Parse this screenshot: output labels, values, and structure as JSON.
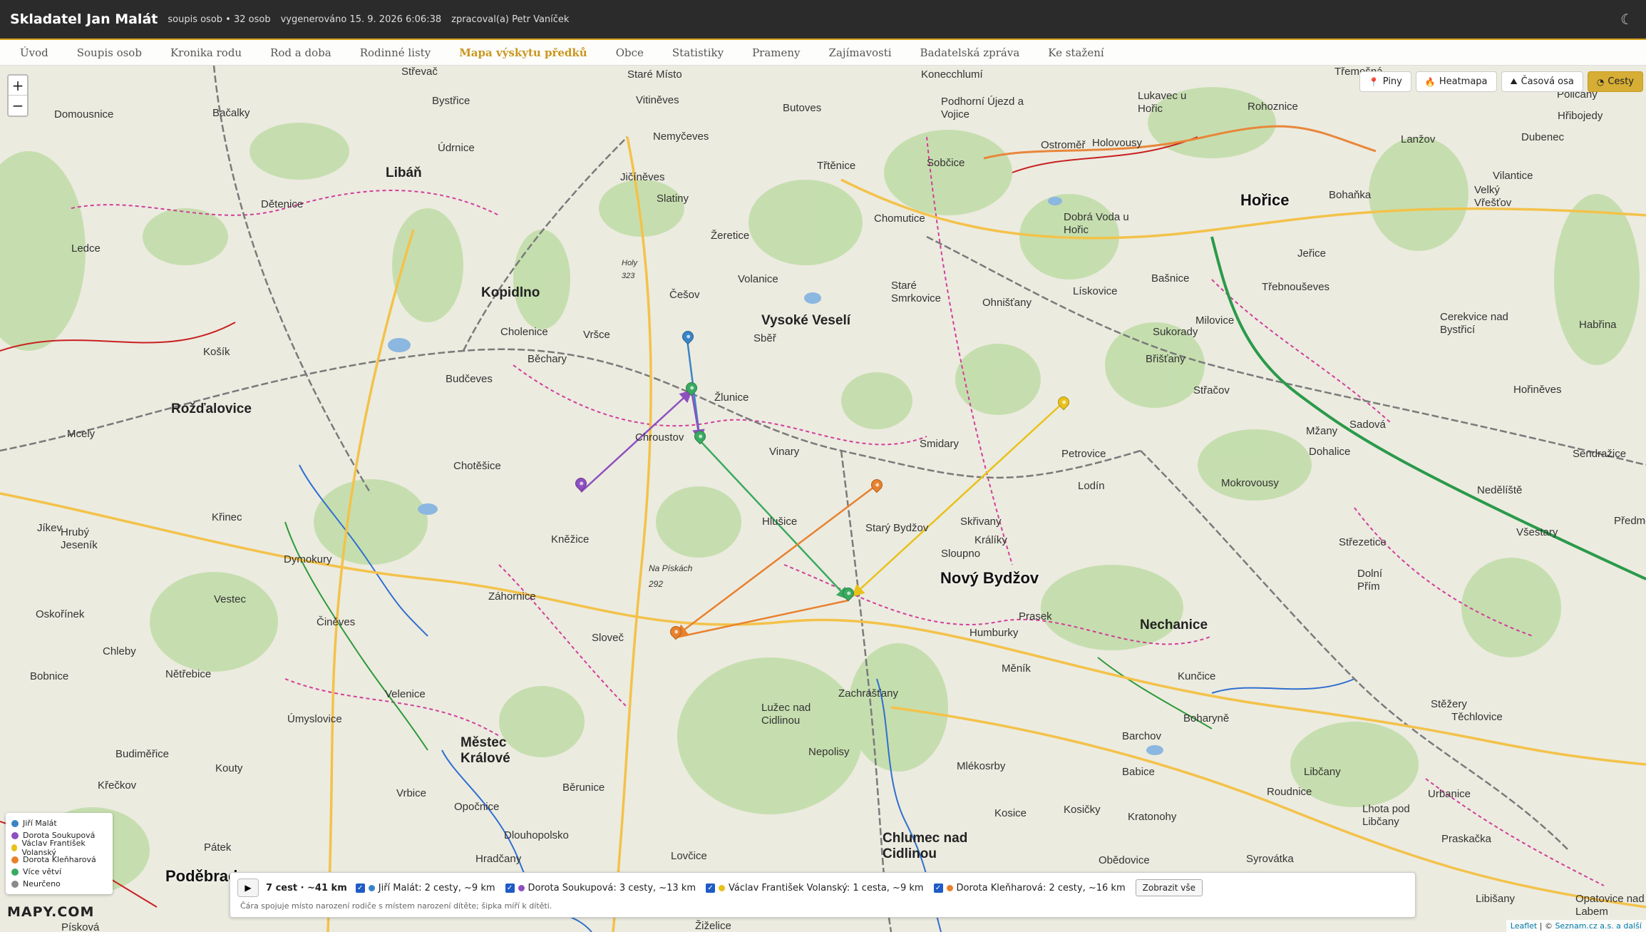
{
  "app": {
    "title": "Skladatel Jan Malát",
    "count": "soupis osob • 32 osob",
    "generated": "vygenerováno 15. 9. 2026 6:06:38",
    "author": "zpracoval(a) Petr Vaníček",
    "theme_icon": "moon-icon"
  },
  "nav": [
    {
      "label": "Úvod"
    },
    {
      "label": "Soupis osob"
    },
    {
      "label": "Kronika rodu"
    },
    {
      "label": "Rod a doba"
    },
    {
      "label": "Rodinné listy"
    },
    {
      "label": "Mapa výskytu předků",
      "active": true
    },
    {
      "label": "Obce"
    },
    {
      "label": "Statistiky"
    },
    {
      "label": "Prameny"
    },
    {
      "label": "Zajímavosti"
    },
    {
      "label": "Badatelská zpráva"
    },
    {
      "label": "Ke stažení"
    }
  ],
  "map": {
    "zoom_in": "+",
    "zoom_out": "−",
    "modes": [
      {
        "label": "Piny",
        "icon": "pin-icon"
      },
      {
        "label": "Heatmapa",
        "icon": "flame-icon"
      },
      {
        "label": "Časová osa",
        "icon": "mountain-icon"
      },
      {
        "label": "Cesty",
        "icon": "route-icon",
        "active": true
      }
    ],
    "places": [
      {
        "name": "Střevač",
        "size": "s"
      },
      {
        "name": "Staré Místo",
        "size": "s"
      },
      {
        "name": "Konecchlumí",
        "size": "s"
      },
      {
        "name": "Třemešná",
        "size": "s"
      },
      {
        "name": "Bystřice",
        "size": "s"
      },
      {
        "name": "Vitiněves",
        "size": "s"
      },
      {
        "name": "Butoves",
        "size": "s"
      },
      {
        "name": "Podhorní Újezd a Vojice",
        "size": "s"
      },
      {
        "name": "Lukavec u Hořic",
        "size": "s"
      },
      {
        "name": "Rohoznice",
        "size": "s"
      },
      {
        "name": "Domousnice",
        "size": "s"
      },
      {
        "name": "Bačalky",
        "size": "s"
      },
      {
        "name": "Nemyčeves",
        "size": "s"
      },
      {
        "name": "Ostroměř",
        "size": "s"
      },
      {
        "name": "Holovousy",
        "size": "s"
      },
      {
        "name": "Libáň",
        "size": "m"
      },
      {
        "name": "Údrnice",
        "size": "s"
      },
      {
        "name": "Jičíněves",
        "size": "s"
      },
      {
        "name": "Třtěnice",
        "size": "s"
      },
      {
        "name": "Sobčice",
        "size": "s"
      },
      {
        "name": "Hořice",
        "size": "l"
      },
      {
        "name": "Dubenec",
        "size": "s"
      },
      {
        "name": "Lanžov",
        "size": "s"
      },
      {
        "name": "Dětenice",
        "size": "s"
      },
      {
        "name": "Slatiny",
        "size": "s"
      },
      {
        "name": "Chomutice",
        "size": "s"
      },
      {
        "name": "Bohaňka",
        "size": "s"
      },
      {
        "name": "Vilantice",
        "size": "s"
      },
      {
        "name": "Ledce",
        "size": "s"
      },
      {
        "name": "Žeretice",
        "size": "s"
      },
      {
        "name": "Dobrá Voda u Hořic",
        "size": "s"
      },
      {
        "name": "Jeřice",
        "size": "s"
      },
      {
        "name": "Volanice",
        "size": "s"
      },
      {
        "name": "Bašnice",
        "size": "s"
      },
      {
        "name": "Třebnouševes",
        "size": "s"
      },
      {
        "name": "Kopidlno",
        "size": "m"
      },
      {
        "name": "Češov",
        "size": "s"
      },
      {
        "name": "Staré Smrkovice",
        "size": "s"
      },
      {
        "name": "Lískovice",
        "size": "s"
      },
      {
        "name": "Ohnišťany",
        "size": "s"
      },
      {
        "name": "Cerekvice nad Bystřicí",
        "size": "s"
      },
      {
        "name": "Vysoké Veselí",
        "size": "m"
      },
      {
        "name": "Cholenice",
        "size": "s"
      },
      {
        "name": "Vršce",
        "size": "s"
      },
      {
        "name": "Sběř",
        "size": "s"
      },
      {
        "name": "Milovice",
        "size": "s"
      },
      {
        "name": "Sukorady",
        "size": "s"
      },
      {
        "name": "Košík",
        "size": "s"
      },
      {
        "name": "Běchary",
        "size": "s"
      },
      {
        "name": "Břišťany",
        "size": "s"
      },
      {
        "name": "Rožďalovice",
        "size": "m"
      },
      {
        "name": "Budčeves",
        "size": "s"
      },
      {
        "name": "Žlunice",
        "size": "s"
      },
      {
        "name": "Střačov",
        "size": "s"
      },
      {
        "name": "Hořiněves",
        "size": "s"
      },
      {
        "name": "Mcely",
        "size": "s"
      },
      {
        "name": "Chroustov",
        "size": "s"
      },
      {
        "name": "Smidary",
        "size": "s"
      },
      {
        "name": "Sadová",
        "size": "s"
      },
      {
        "name": "Mžany",
        "size": "s"
      },
      {
        "name": "Vinary",
        "size": "s"
      },
      {
        "name": "Petrovice",
        "size": "s"
      },
      {
        "name": "Dohalice",
        "size": "s"
      },
      {
        "name": "Chotěšice",
        "size": "s"
      },
      {
        "name": "Lodín",
        "size": "s"
      },
      {
        "name": "Mokrovousy",
        "size": "s"
      },
      {
        "name": "Nedělíště",
        "size": "s"
      },
      {
        "name": "Křinec",
        "size": "s"
      },
      {
        "name": "Hlušice",
        "size": "s"
      },
      {
        "name": "Skřivany",
        "size": "s"
      },
      {
        "name": "Starý Bydžov",
        "size": "s"
      },
      {
        "name": "Jíkev",
        "size": "s"
      },
      {
        "name": "Kněžice",
        "size": "s"
      },
      {
        "name": "Králíky",
        "size": "s"
      },
      {
        "name": "Hrubý Jeseník",
        "size": "s"
      },
      {
        "name": "Sloupno",
        "size": "s"
      },
      {
        "name": "Střezetice",
        "size": "s"
      },
      {
        "name": "Všestary",
        "size": "s"
      },
      {
        "name": "Nový Bydžov",
        "size": "l"
      },
      {
        "name": "Dolní Přím",
        "size": "s"
      },
      {
        "name": "Dymokury",
        "size": "s"
      },
      {
        "name": "Na Pískách 292",
        "size": "s"
      },
      {
        "name": "Vestec",
        "size": "s"
      },
      {
        "name": "Záhornice",
        "size": "s"
      },
      {
        "name": "Prasek",
        "size": "s"
      },
      {
        "name": "Oskořínek",
        "size": "s"
      },
      {
        "name": "Činěves",
        "size": "s"
      },
      {
        "name": "Nechanice",
        "size": "m"
      },
      {
        "name": "Humburky",
        "size": "s"
      },
      {
        "name": "Sloveč",
        "size": "s"
      },
      {
        "name": "Chleby",
        "size": "s"
      },
      {
        "name": "Nětřebice",
        "size": "s"
      },
      {
        "name": "Měník",
        "size": "s"
      },
      {
        "name": "Kunčice",
        "size": "s"
      },
      {
        "name": "Bobnice",
        "size": "s"
      },
      {
        "name": "Zachrašťany",
        "size": "s"
      },
      {
        "name": "Velenice",
        "size": "s"
      },
      {
        "name": "Stěžery",
        "size": "s"
      },
      {
        "name": "Lužec nad Cidlinou",
        "size": "s"
      },
      {
        "name": "Boharyně",
        "size": "s"
      },
      {
        "name": "Těchlovice",
        "size": "s"
      },
      {
        "name": "Úmyslovice",
        "size": "s"
      },
      {
        "name": "Městec Králové",
        "size": "m"
      },
      {
        "name": "Barchov",
        "size": "s"
      },
      {
        "name": "Budiměřice",
        "size": "s"
      },
      {
        "name": "Nepolisy",
        "size": "s"
      },
      {
        "name": "Mlékosrby",
        "size": "s"
      },
      {
        "name": "Kouty",
        "size": "s"
      },
      {
        "name": "Babice",
        "size": "s"
      },
      {
        "name": "Libčany",
        "size": "s"
      },
      {
        "name": "Křečkov",
        "size": "s"
      },
      {
        "name": "Běruniсe",
        "size": "s"
      },
      {
        "name": "Roudnice",
        "size": "s"
      },
      {
        "name": "Urbanice",
        "size": "s"
      },
      {
        "name": "Vrbice",
        "size": "s"
      },
      {
        "name": "Opočnice",
        "size": "s"
      },
      {
        "name": "Kosice",
        "size": "s"
      },
      {
        "name": "Kratonohy",
        "size": "s"
      },
      {
        "name": "Kosičky",
        "size": "s"
      },
      {
        "name": "Lhota pod Libčany",
        "size": "s"
      },
      {
        "name": "Chlumec nad Cidlinou",
        "size": "m"
      },
      {
        "name": "Dlouhopolsko",
        "size": "s"
      },
      {
        "name": "Praskačka",
        "size": "s"
      },
      {
        "name": "Pátek",
        "size": "s"
      },
      {
        "name": "Hradčany",
        "size": "s"
      },
      {
        "name": "Lovčice",
        "size": "s"
      },
      {
        "name": "Obědovice",
        "size": "s"
      },
      {
        "name": "Syrovátka",
        "size": "s"
      },
      {
        "name": "Poděbrady",
        "size": "l"
      },
      {
        "name": "Libišany",
        "size": "s"
      },
      {
        "name": "Opatovice nad Labem",
        "size": "s"
      },
      {
        "name": "Písková",
        "size": "s"
      },
      {
        "name": "Žiželice",
        "size": "s"
      },
      {
        "name": "Holy 323",
        "size": "s"
      },
      {
        "name": "Policany",
        "size": "s"
      },
      {
        "name": "Hřibojedy",
        "size": "s"
      },
      {
        "name": "Velký Vřešťov",
        "size": "s"
      },
      {
        "name": "Habřina",
        "size": "s"
      },
      {
        "name": "Sendražice",
        "size": "s"
      },
      {
        "name": "Předměřice",
        "size": "s"
      }
    ],
    "legend": [
      {
        "label": "Jiří Malát",
        "color": "#3a84c6"
      },
      {
        "label": "Dorota Soukupová",
        "color": "#8e4fbf"
      },
      {
        "label": "Václav František Volanský",
        "color": "#e8c11a"
      },
      {
        "label": "Dorota Kleňharová",
        "color": "#e8812d"
      },
      {
        "label": "Více větví",
        "color": "#3aaa5f"
      },
      {
        "label": "Neurčeno",
        "color": "#8a8a8a"
      }
    ],
    "logo": "MAPY.COM",
    "attribution": {
      "leaflet": "Leaflet",
      "sep": " | © ",
      "provider": "Seznam.cz a.s. a další"
    }
  },
  "routes": {
    "play_icon": "play-icon",
    "play_label": "▶",
    "summary": "7 cest · ~41 km",
    "people": [
      {
        "label": "Jiří Malát: 2 cesty, ~9 km",
        "color": "#3a84c6"
      },
      {
        "label": "Dorota Soukupová: 3 cesty, ~13 km",
        "color": "#8e4fbf"
      },
      {
        "label": "Václav František Volanský: 1 cesta, ~9 km",
        "color": "#e8c11a"
      },
      {
        "label": "Dorota Kleňharová: 2 cesty, ~16 km",
        "color": "#e8812d"
      }
    ],
    "show_all": "Zobrazit vše",
    "hint": "Čára spojuje místo narození rodiče s místem narození dítěte; šipka míří k dítěti."
  }
}
